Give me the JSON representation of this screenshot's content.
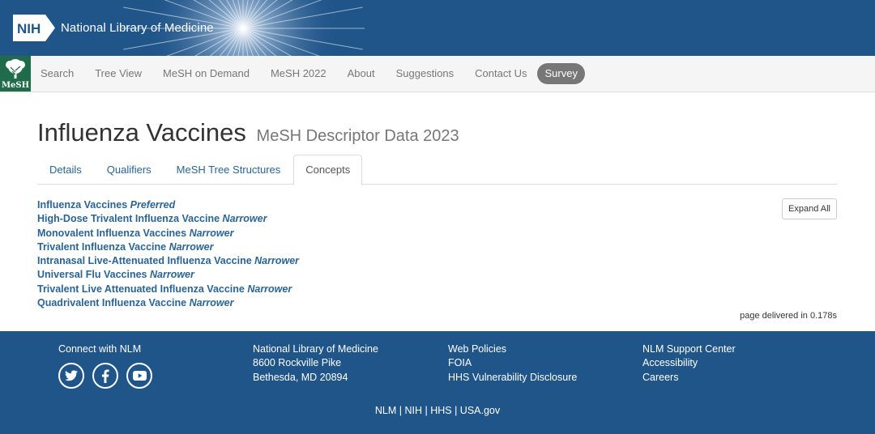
{
  "banner": {
    "badge": "NIH",
    "title": "National Library of Medicine"
  },
  "nav": {
    "logo_text": "MeSH",
    "items": [
      "Search",
      "Tree View",
      "MeSH on Demand",
      "MeSH 2022",
      "About",
      "Suggestions",
      "Contact Us"
    ],
    "survey": "Survey"
  },
  "page": {
    "title": "Influenza Vaccines",
    "subtitle": "MeSH Descriptor Data 2023"
  },
  "tabs": [
    "Details",
    "Qualifiers",
    "MeSH Tree Structures",
    "Concepts"
  ],
  "active_tab": "Concepts",
  "concepts": [
    {
      "name": "Influenza Vaccines",
      "relation": "Preferred"
    },
    {
      "name": "High-Dose Trivalent Influenza Vaccine",
      "relation": "Narrower"
    },
    {
      "name": "Monovalent Influenza Vaccines",
      "relation": "Narrower"
    },
    {
      "name": "Trivalent Influenza Vaccine",
      "relation": "Narrower"
    },
    {
      "name": "Intranasal Live-Attenuated Influenza Vaccine",
      "relation": "Narrower"
    },
    {
      "name": "Universal Flu Vaccines",
      "relation": "Narrower"
    },
    {
      "name": "Trivalent Live Attenuated Influenza Vaccine",
      "relation": "Narrower"
    },
    {
      "name": "Quadrivalent Influenza Vaccine",
      "relation": "Narrower"
    }
  ],
  "expand_all": "Expand All",
  "delivered": "page delivered in 0.178s",
  "footer": {
    "connect": "Connect with NLM",
    "social_icons": [
      "twitter-icon",
      "facebook-icon",
      "youtube-icon"
    ],
    "address": [
      "National Library of Medicine",
      "8600 Rockville Pike",
      "Bethesda, MD 20894"
    ],
    "policies": [
      "Web Policies",
      "FOIA",
      "HHS Vulnerability Disclosure"
    ],
    "support": [
      "NLM Support Center",
      "Accessibility",
      "Careers"
    ],
    "bottom_links": [
      "NLM",
      "NIH",
      "HHS",
      "USA.gov"
    ]
  },
  "colors": {
    "brand_blue": "#20558a",
    "link_blue": "#2a6496",
    "mesh_green": "#1f6b4a",
    "survey_gray": "#777777"
  }
}
